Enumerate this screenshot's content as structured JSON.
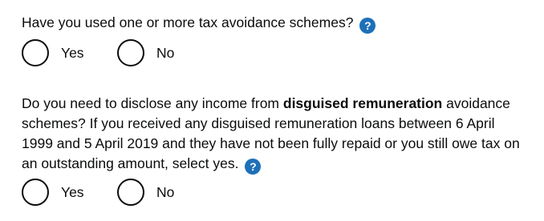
{
  "q1": {
    "text": "Have you used one or more tax avoidance schemes?",
    "help_glyph": "?",
    "options": {
      "yes": "Yes",
      "no": "No"
    }
  },
  "q2": {
    "text_before": "Do you need to disclose any income from ",
    "text_bold": "disguised remuneration",
    "text_after": " avoidance schemes? If you received any disguised remuneration loans between 6 April 1999 and 5 April 2019 and they have not been fully repaid or you still owe tax on an outstanding amount, select yes.",
    "help_glyph": "?",
    "options": {
      "yes": "Yes",
      "no": "No"
    }
  },
  "colors": {
    "text": "#0b0c0c",
    "help_icon": "#1d70b8"
  },
  "icons": {
    "help": "question-mark-help-icon"
  }
}
